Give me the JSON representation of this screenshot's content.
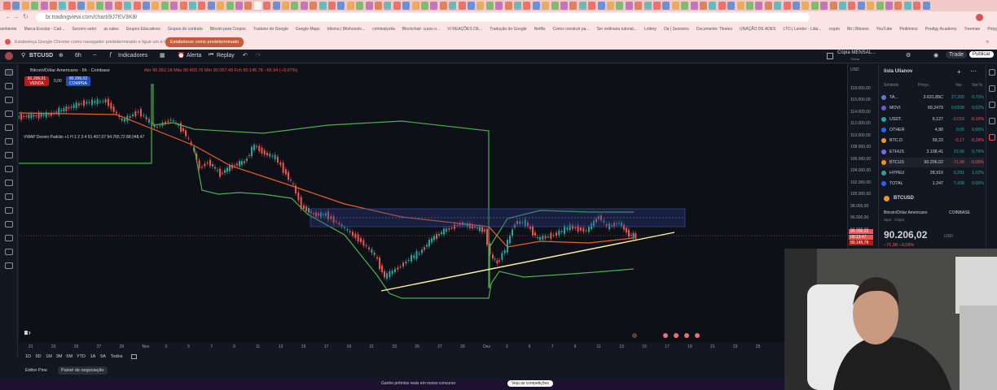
{
  "browser": {
    "url": "br.tradingview.com/chart/9J7EV3K8/",
    "bookmarks": [
      "ambiente",
      "Marca Escolar - Cad...",
      "Socorro setor",
      "as sales",
      "Grupos Educativos",
      "Grupos do contrato",
      "Bitcoin para Corpos",
      "Tradutor do Google",
      "Google Maps",
      "Idioma | Bitshonolo...",
      "criminalystia",
      "Blockchair: curso o...",
      "VI REAÇÕES DE...",
      "Tradução do Google",
      "Netflix",
      "Como construir pa...",
      "Ser ordinaria tutorial...",
      "Lottery",
      "Da | Sessions",
      "Documento: Tiketes",
      "UNAÇÃO DE ADES",
      "LTO | Lender - Lida...",
      "crypto",
      "Bit | Bitonos",
      "YouTube",
      "Pedirimos",
      "Prodigy Academy",
      "Treeman",
      "Polygon Galaxy"
    ],
    "info_text": "Estabeleça Google Chrome como navegador predeterminado e ligue um à barra de tarefas",
    "set_default_label": "Estabelecer como predeterminado"
  },
  "toolbar": {
    "symbol": "BTCUSD",
    "interval": "6h",
    "indicators_label": "Indicadores",
    "alert_label": "Alerta",
    "replay_label": "Replay",
    "layout_label": "Cópia MENSAL...",
    "layout_sub": "Salvar",
    "trade_label": "Trade",
    "publish_label": "Publicar"
  },
  "chart": {
    "title": "Bitcoin/Dólar Americano · 6h · Coinbase",
    "ohlc": "Abr 90.362,18  Máx 90.403,76  Mín 90.057,49  Fch 90.145,78  −65,94 (−0,07%)",
    "sell_price": "91.206,01",
    "sell_label": "VENDA",
    "spread": "0,00",
    "buy_price": "90.206,02",
    "buy_label": "COMPRA",
    "vwap_legend": "VWAP Desvio Padrão +1 H 1 2 3 4  91.407,07  94.765,72  88.048,47",
    "last_price_tag": "90.206,02",
    "last_time_tag": "00:13:47",
    "last_price_tag2": "90.145,78",
    "time_labels": [
      "21",
      "23",
      "25",
      "27",
      "29",
      "Nov",
      "3",
      "5",
      "7",
      "9",
      "11",
      "13",
      "15",
      "17",
      "19",
      "21",
      "23",
      "25",
      "27",
      "29",
      "Dez",
      "3",
      "5",
      "7",
      "9",
      "11",
      "13",
      "15",
      "17",
      "19",
      "21",
      "23",
      "25"
    ],
    "price_labels": [
      "USD",
      "118.000,00",
      "116.000,00",
      "114.000,00",
      "112.000,00",
      "110.000,00",
      "108.000,00",
      "106.000,00",
      "104.000,00",
      "102.000,00",
      "100.000,00",
      "98.000,00",
      "96.000,00",
      "94.000,00",
      "92.000,00"
    ],
    "ranges": [
      "1D",
      "5D",
      "1M",
      "3M",
      "6M",
      "YTD",
      "1A",
      "5A",
      "Todos"
    ],
    "bottom_tabs": [
      "Editor Pine",
      "Painel de negociação"
    ],
    "bottom_strip_text": "Ganhe prêmios reais em nosso concurso",
    "bottom_strip_btn": "Veja as competições"
  },
  "watchlist": {
    "title": "lista Ulianov",
    "col_symbol": "Símbolo",
    "col_price": "Preço",
    "col_change": "Var.",
    "col_pct": "Var.%",
    "rows": [
      {
        "sym": "TA...",
        "price": "3.631,85C",
        "chg": "27,200",
        "pct": "0,75%",
        "dir": "up",
        "color": "#5b7bd5"
      },
      {
        "sym": "MOVI",
        "price": "69,2479",
        "chg": "0,0108",
        "pct": "0,02%",
        "dir": "up",
        "color": "#6a5acd"
      },
      {
        "sym": "USDT.",
        "price": "6,127",
        "chg": "-0,010",
        "pct": "-0,16%",
        "dir": "dn",
        "color": "#26a69a"
      },
      {
        "sym": "OTHER",
        "price": "4,90",
        "chg": "0,05",
        "pct": "0,66%",
        "dir": "up",
        "color": "#2962ff"
      },
      {
        "sym": "BTC.D",
        "price": "59,23",
        "chg": "-0,17",
        "pct": "-0,28%",
        "dir": "dn",
        "color": "#f7931a"
      },
      {
        "sym": "ETHUS",
        "price": "3.108,41",
        "chg": "23,55",
        "pct": "0,76%",
        "dir": "up",
        "color": "#7b68ee"
      },
      {
        "sym": "BTCUS",
        "price": "90.206,02",
        "chg": "-71,98",
        "pct": "-0,08%",
        "dir": "dn",
        "color": "#f7931a"
      },
      {
        "sym": "HYPEU",
        "price": "28,910",
        "chg": "0,291",
        "pct": "1,02%",
        "dir": "up",
        "color": "#26a69a"
      },
      {
        "sym": "TOTAL",
        "price": "1.247",
        "chg": "7,438",
        "pct": "0,60%",
        "dir": "up",
        "color": "#2962ff"
      }
    ],
    "detail_symbol": "BTCUSD",
    "detail_name": "Bitcoin/Dólar Americano",
    "detail_exchange": "COINBASE",
    "detail_type": "Spot · Cripto",
    "detail_price": "90.206,02",
    "detail_currency": "USD",
    "detail_change": "−71,98  −0,08%"
  }
}
